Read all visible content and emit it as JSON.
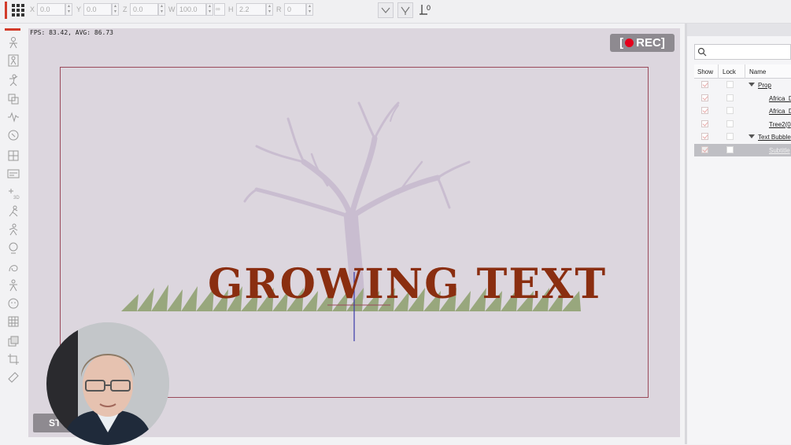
{
  "toolbar": {
    "fields": [
      {
        "label": "X",
        "value": "0.0"
      },
      {
        "label": "Y",
        "value": "0.0"
      },
      {
        "label": "Z",
        "value": "0.0"
      },
      {
        "label": "W",
        "value": "100.0"
      },
      {
        "label": "H",
        "value": "2.2"
      },
      {
        "label": "R",
        "value": "0"
      }
    ],
    "align_value": "0"
  },
  "viewport": {
    "fps_text": "FPS: 83.42, AVG: 86.73",
    "rec_label": "REC",
    "scene_title": "GROWING TEXT",
    "stop_button_label": "ST"
  },
  "scene_manager": {
    "search_placeholder": "",
    "columns": {
      "show": "Show",
      "lock": "Lock",
      "name": "Name"
    },
    "rows": [
      {
        "name": "Prop",
        "type": "group"
      },
      {
        "name": "Africa_D",
        "type": "item"
      },
      {
        "name": "Africa_D",
        "type": "item"
      },
      {
        "name": "Tree2(0",
        "type": "item"
      },
      {
        "name": "Text Bubble",
        "type": "group"
      },
      {
        "name": "Subtitle",
        "type": "item",
        "selected": true
      }
    ]
  },
  "colors": {
    "accent_red": "#d23b2a",
    "rec_dot": "#e4001b",
    "title_text": "#8a2e10",
    "frame_border": "#9a4a5a",
    "viewport_bg": "#dcd6de"
  }
}
